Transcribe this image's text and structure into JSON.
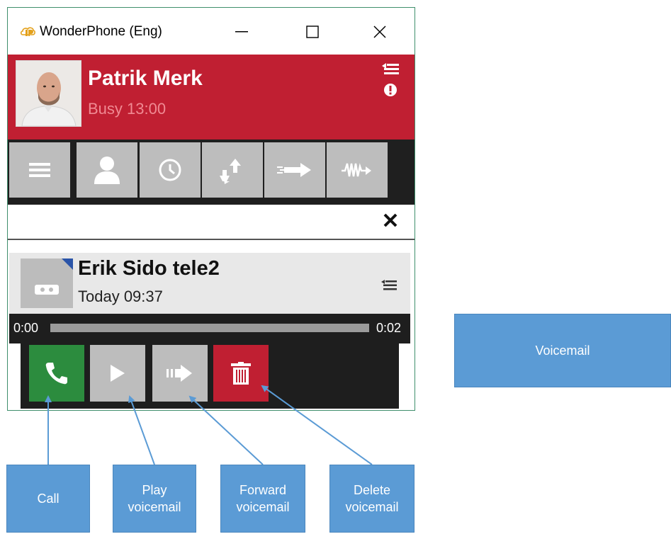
{
  "window": {
    "title": "WonderPhone (Eng)",
    "controls": [
      "minimize",
      "maximize",
      "close"
    ]
  },
  "header": {
    "contact_name": "Patrik Merk",
    "status": "Busy 13:00",
    "background_color": "#c01f32"
  },
  "toolbar": {
    "buttons": [
      {
        "name": "menu",
        "icon": "hamburger-icon"
      },
      {
        "name": "contacts",
        "icon": "person-icon"
      },
      {
        "name": "history",
        "icon": "clock-icon"
      },
      {
        "name": "transfer",
        "icon": "transfer-arrows-icon"
      },
      {
        "name": "forward",
        "icon": "forward-arrow-icon"
      },
      {
        "name": "voicemail",
        "icon": "waveform-icon"
      }
    ]
  },
  "search": {
    "value": "",
    "close_icon": "close-x-icon"
  },
  "voicemail_item": {
    "caller": "Erik Sido tele2",
    "time": "Today 09:37",
    "thumb_icon": "cassette-icon"
  },
  "playback": {
    "start": "0:00",
    "end": "0:02",
    "progress_fraction": 0
  },
  "actions": [
    {
      "name": "call",
      "icon": "phone-icon",
      "color": "#2c8c3e"
    },
    {
      "name": "play",
      "icon": "play-icon",
      "color": "#bdbdbd"
    },
    {
      "name": "forward",
      "icon": "forward-icon",
      "color": "#bdbdbd"
    },
    {
      "name": "delete",
      "icon": "trash-icon",
      "color": "#c01f32"
    }
  ],
  "annotations": {
    "title": "Voicemail",
    "call": "Call",
    "play": "Play\nvoicemail",
    "forward": "Forward\nvoicemail",
    "delete": "Delete\nvoicemail"
  },
  "colors": {
    "callout": "#5b9bd5",
    "toolbar_bg": "#1f1f1f",
    "button_gray": "#bdbdbd"
  }
}
